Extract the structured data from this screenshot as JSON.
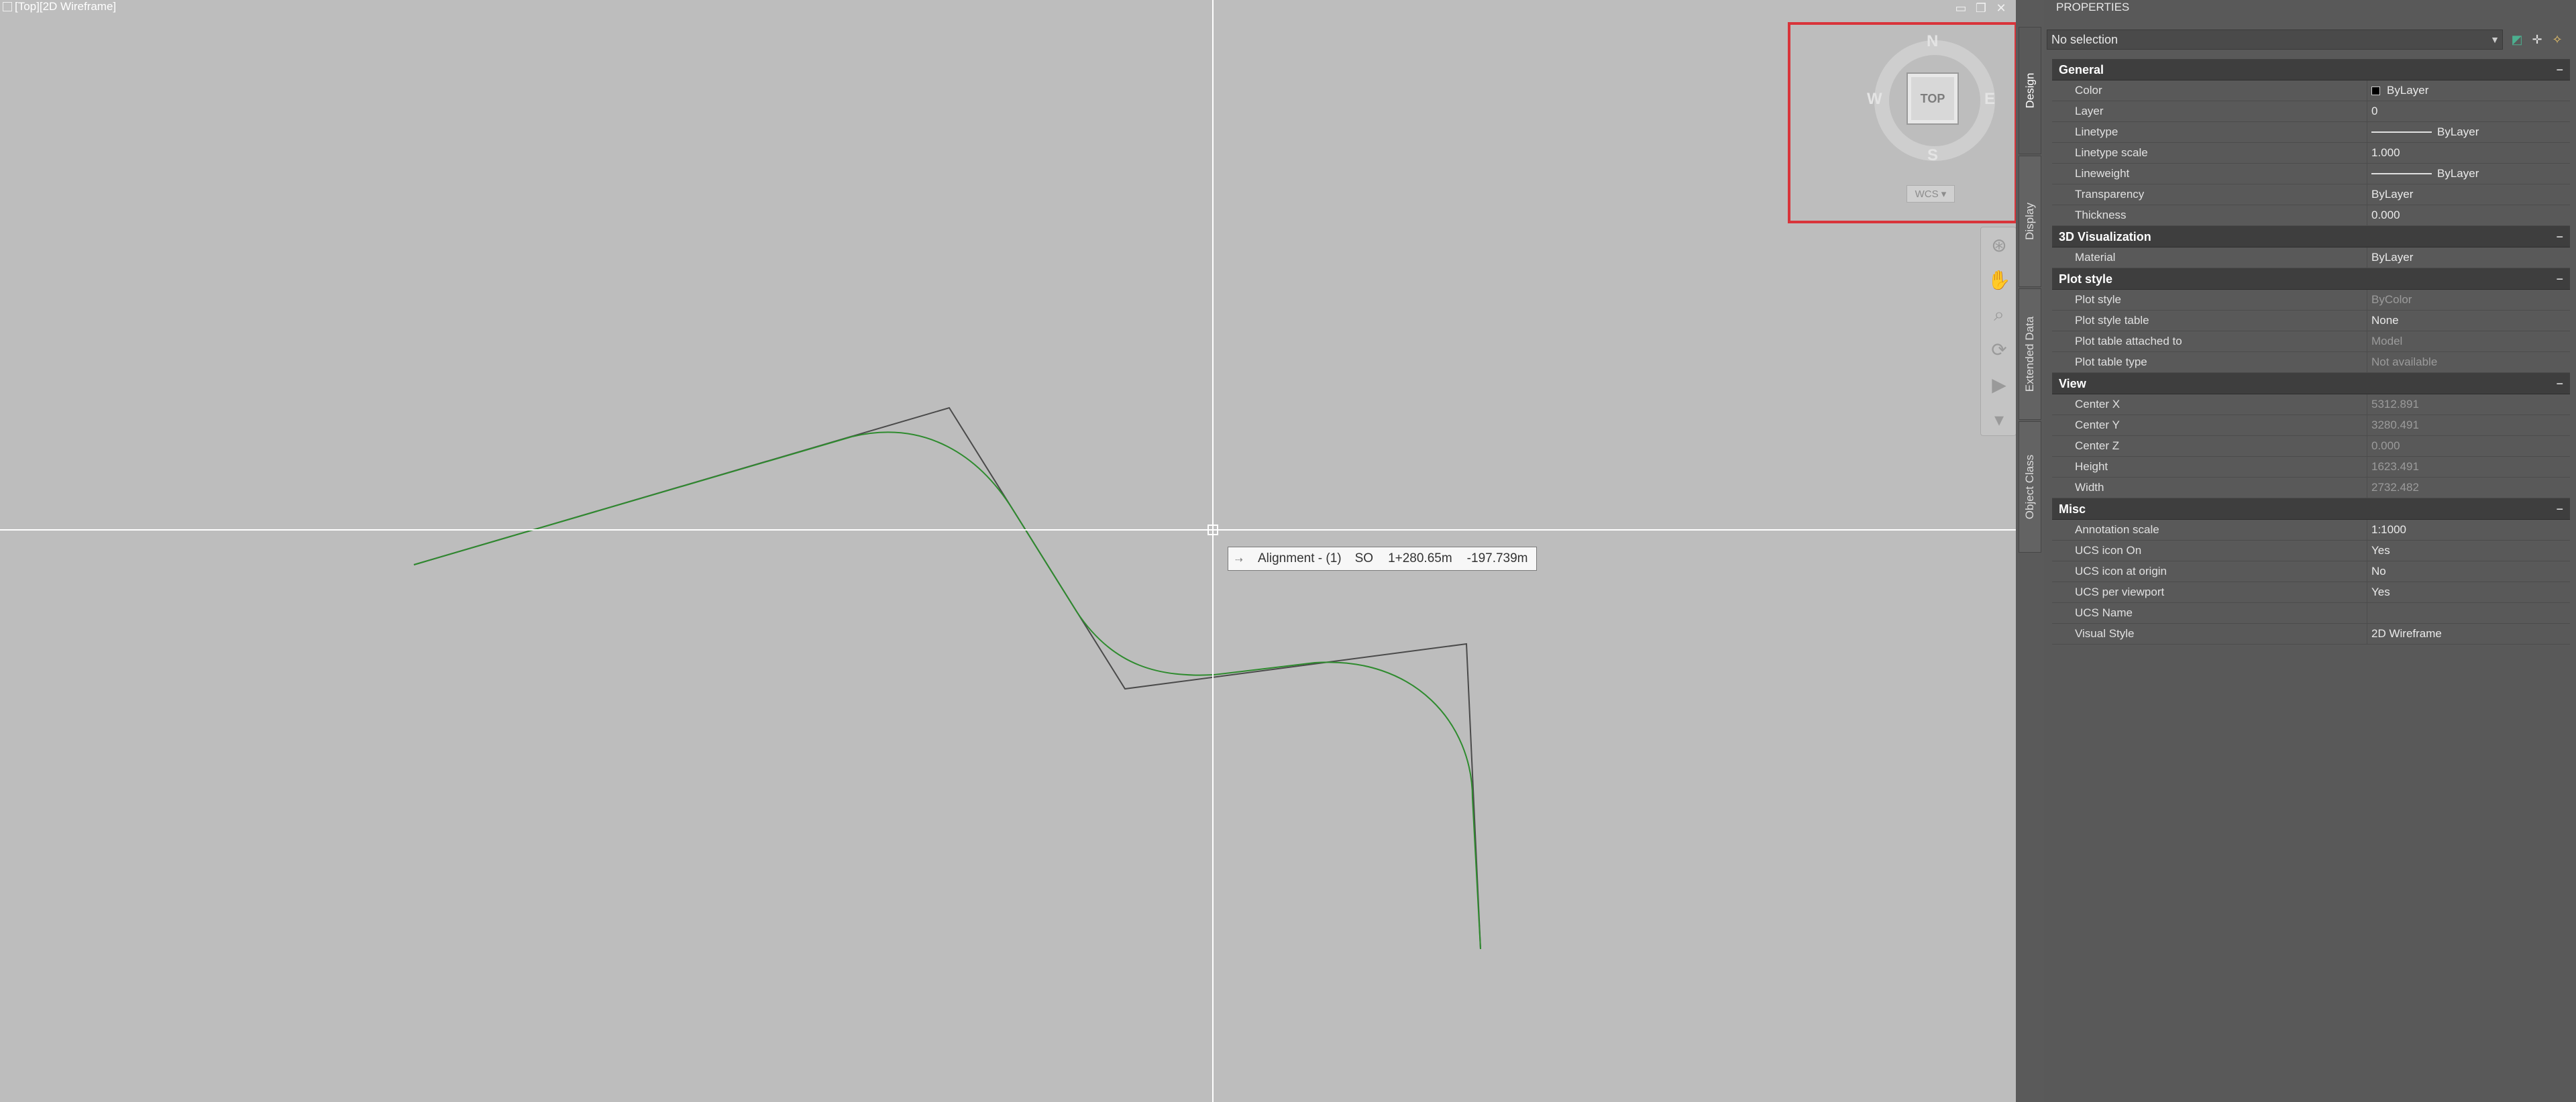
{
  "viewport": {
    "label": "[Top][2D Wireframe]",
    "tooltip": {
      "name": "Alignment - (1)",
      "side": "SO",
      "station": "1+280.65m",
      "offset": "-197.739m"
    },
    "viewcube": {
      "face": "TOP",
      "north": "N",
      "south": "S",
      "east": "E",
      "west": "W",
      "ucs": "WCS"
    },
    "colors": {
      "background": "#bdbdbd",
      "alignment": "#2e8b2e",
      "tangent": "#4a4a4a",
      "crosshair": "#ffffff",
      "highlight": "#d9343a"
    }
  },
  "tabs": [
    "Design",
    "Display",
    "Extended Data",
    "Object Class"
  ],
  "panel": {
    "title": "PROPERTIES",
    "selection": "No selection",
    "sections": [
      {
        "name": "General",
        "rows": [
          {
            "name": "Color",
            "value": "ByLayer"
          },
          {
            "name": "Layer",
            "value": "0"
          },
          {
            "name": "Linetype",
            "value": "ByLayer"
          },
          {
            "name": "Linetype scale",
            "value": "1.000"
          },
          {
            "name": "Lineweight",
            "value": "ByLayer"
          },
          {
            "name": "Transparency",
            "value": "ByLayer"
          },
          {
            "name": "Thickness",
            "value": "0.000"
          }
        ]
      },
      {
        "name": "3D Visualization",
        "rows": [
          {
            "name": "Material",
            "value": "ByLayer"
          }
        ]
      },
      {
        "name": "Plot style",
        "rows": [
          {
            "name": "Plot style",
            "value": "ByColor"
          },
          {
            "name": "Plot style table",
            "value": "None"
          },
          {
            "name": "Plot table attached to",
            "value": "Model"
          },
          {
            "name": "Plot table type",
            "value": "Not available"
          }
        ]
      },
      {
        "name": "View",
        "rows": [
          {
            "name": "Center X",
            "value": "5312.891"
          },
          {
            "name": "Center Y",
            "value": "3280.491"
          },
          {
            "name": "Center Z",
            "value": "0.000"
          },
          {
            "name": "Height",
            "value": "1623.491"
          },
          {
            "name": "Width",
            "value": "2732.482"
          }
        ]
      },
      {
        "name": "Misc",
        "rows": [
          {
            "name": "Annotation scale",
            "value": "1:1000"
          },
          {
            "name": "UCS icon On",
            "value": "Yes"
          },
          {
            "name": "UCS icon at origin",
            "value": "No"
          },
          {
            "name": "UCS per viewport",
            "value": "Yes"
          },
          {
            "name": "UCS Name",
            "value": ""
          },
          {
            "name": "Visual Style",
            "value": "2D Wireframe"
          }
        ]
      }
    ]
  }
}
